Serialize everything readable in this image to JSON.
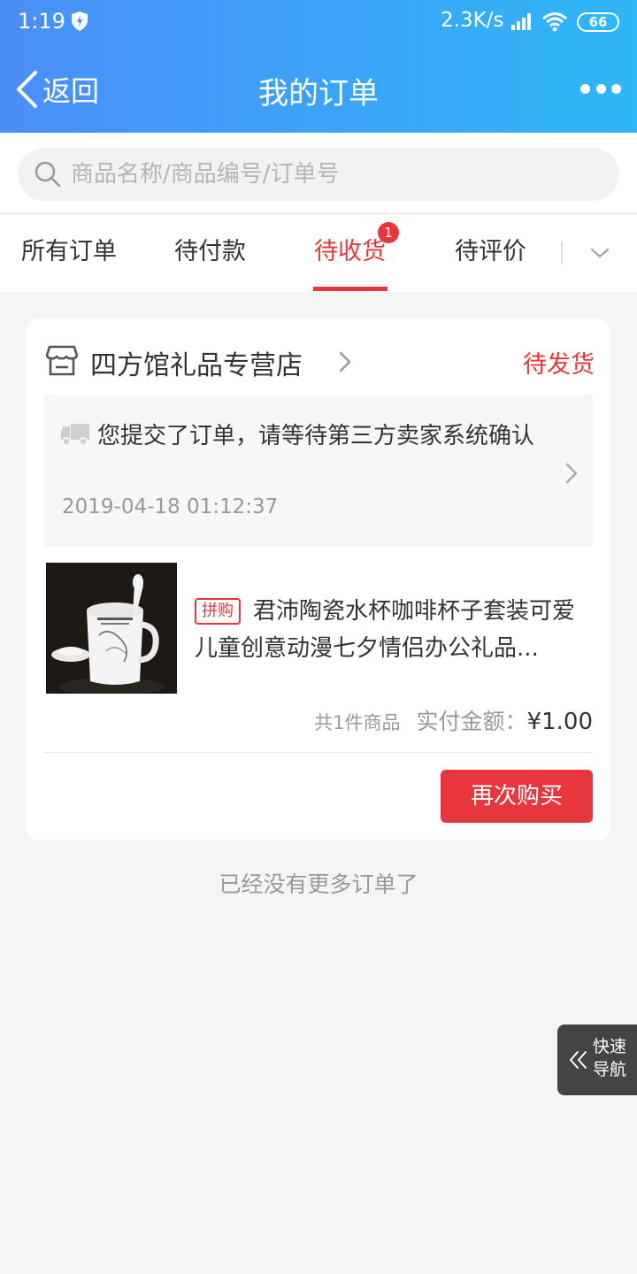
{
  "status_bar": {
    "time": "1:19",
    "net_speed": "2.3K/s",
    "battery": "66"
  },
  "header": {
    "back_label": "返回",
    "title": "我的订单"
  },
  "search": {
    "placeholder": "商品名称/商品编号/订单号"
  },
  "tabs": {
    "items": [
      "所有订单",
      "待付款",
      "待收货",
      "待评价"
    ],
    "active_index": 2,
    "badge": "1"
  },
  "order": {
    "shop_name": "四方馆礼品专营店",
    "status": "待发货",
    "notice": "您提交了订单，请等待第三方卖家系统确认",
    "notice_time": "2019-04-18 01:12:37",
    "product_tag": "拼购",
    "product_title": "君沛陶瓷水杯咖啡杯子套装可爱儿童创意动漫七夕情侣办公礼品...",
    "summary_count": "共1件商品",
    "summary_label": "实付金额：",
    "summary_amount": "¥1.00",
    "rebuy_label": "再次购买"
  },
  "footer": {
    "no_more": "已经没有更多订单了"
  },
  "quick_nav": {
    "label": "快速导航"
  },
  "colors": {
    "header_start": "#4b8ef8",
    "header_end": "#2fb7f7",
    "accent_red": "#e8373c"
  }
}
